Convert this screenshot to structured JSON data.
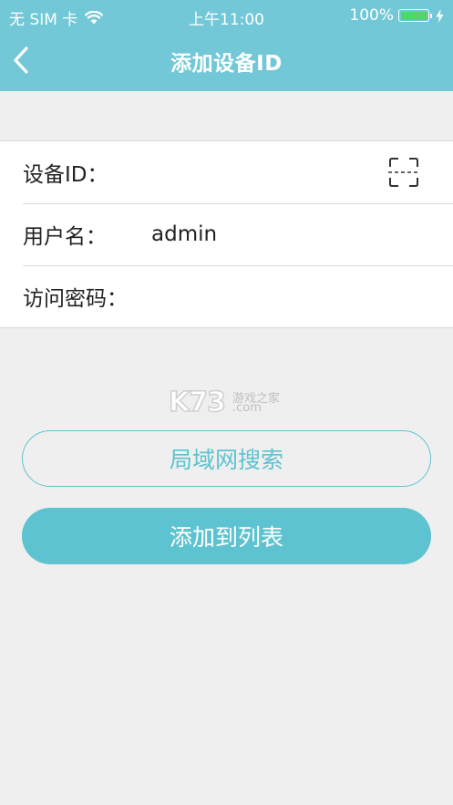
{
  "status_bar": {
    "carrier": "无 SIM 卡",
    "time": "上午11:00",
    "battery_percent": "100%",
    "battery_level": 1.0,
    "battery_color": "#4cd964",
    "wifi_icon": "wifi-icon",
    "charging_icon": "bolt-icon"
  },
  "nav": {
    "title": "添加设备ID",
    "back_icon": "chevron-left-icon"
  },
  "form": {
    "device_id": {
      "label": "设备ID：",
      "value": "",
      "scan_icon": "scan-icon"
    },
    "username": {
      "label": "用户名：",
      "value": "admin"
    },
    "password": {
      "label": "访问密码：",
      "value": ""
    }
  },
  "watermark": {
    "logo": "K73",
    "site_cn": "游戏之家",
    "site_domain": ".com"
  },
  "actions": {
    "lan_search_label": "局域网搜索",
    "add_to_list_label": "添加到列表"
  },
  "colors": {
    "header": "#72c8d6",
    "accent": "#5ec3d0",
    "background": "#efefef"
  }
}
